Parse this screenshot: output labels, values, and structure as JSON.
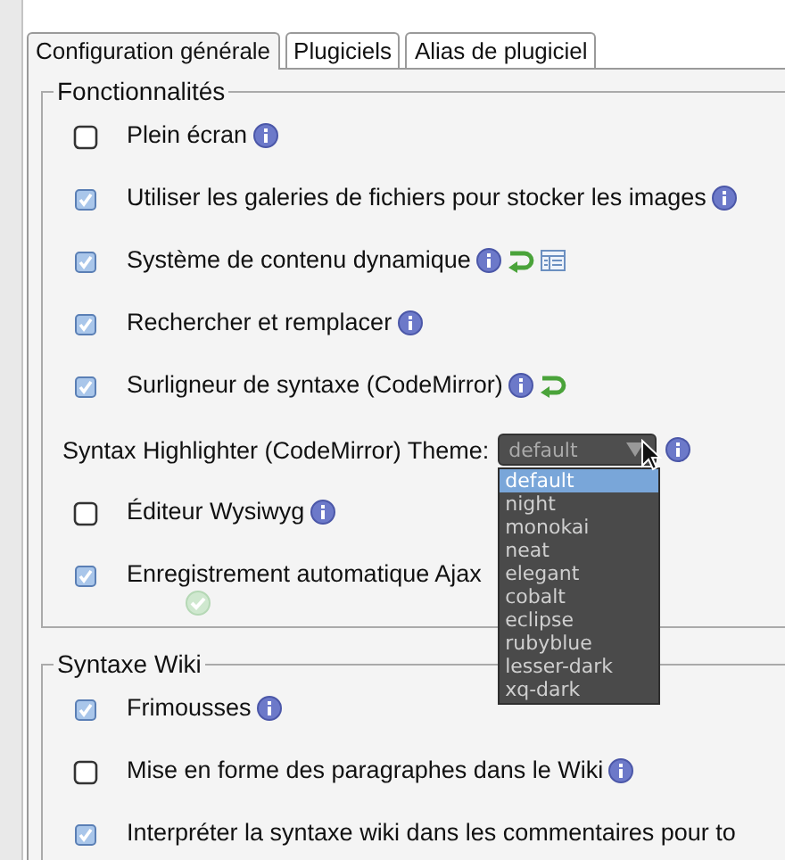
{
  "tabs": [
    {
      "label": "Configuration générale",
      "selected": true
    },
    {
      "label": "Plugiciels",
      "selected": false
    },
    {
      "label": "Alias de plugiciel",
      "selected": false
    }
  ],
  "sections": [
    {
      "legend": "Fonctionnalités",
      "rows": [
        {
          "kind": "checkbox",
          "label": "Plein écran",
          "checked": false,
          "icons": [
            {
              "kind": "info"
            }
          ]
        },
        {
          "kind": "checkbox",
          "label": "Utiliser les galeries de fichiers pour stocker les images",
          "checked": true,
          "icons": [
            {
              "kind": "info"
            }
          ]
        },
        {
          "kind": "checkbox",
          "label": "Système de contenu dynamique",
          "checked": true,
          "icons": [
            {
              "kind": "info"
            },
            {
              "kind": "undo"
            },
            {
              "kind": "table"
            }
          ]
        },
        {
          "kind": "checkbox",
          "label": "Rechercher et remplacer",
          "checked": true,
          "icons": [
            {
              "kind": "info"
            }
          ]
        },
        {
          "kind": "checkbox",
          "label": "Surligneur de syntaxe (CodeMirror)",
          "checked": true,
          "icons": [
            {
              "kind": "info"
            },
            {
              "kind": "undo"
            }
          ]
        },
        {
          "kind": "select",
          "label": "Syntax Highlighter (CodeMirror) Theme:",
          "value": "default",
          "icons": [
            {
              "kind": "info"
            }
          ],
          "options": [
            {
              "label": "default",
              "selected": true
            },
            {
              "label": "night",
              "selected": false
            },
            {
              "label": "monokai",
              "selected": false
            },
            {
              "label": "neat",
              "selected": false
            },
            {
              "label": "elegant",
              "selected": false
            },
            {
              "label": "cobalt",
              "selected": false
            },
            {
              "label": "eclipse",
              "selected": false
            },
            {
              "label": "rubyblue",
              "selected": false
            },
            {
              "label": "lesser-dark",
              "selected": false
            },
            {
              "label": "xq-dark",
              "selected": false
            }
          ]
        },
        {
          "kind": "checkbox",
          "label": "Éditeur Wysiwyg",
          "checked": false,
          "icons": [
            {
              "kind": "info"
            }
          ]
        },
        {
          "kind": "checkbox",
          "label": "Enregistrement automatique Ajax",
          "checked": true,
          "below_icons": [
            {
              "kind": "ok"
            }
          ]
        }
      ]
    },
    {
      "legend": "Syntaxe Wiki",
      "rows": [
        {
          "kind": "checkbox",
          "label": "Frimousses",
          "checked": true,
          "icons": [
            {
              "kind": "info"
            }
          ]
        },
        {
          "kind": "checkbox",
          "label": "Mise en forme des paragraphes dans le Wiki",
          "checked": false,
          "icons": [
            {
              "kind": "info"
            }
          ]
        },
        {
          "kind": "checkbox",
          "label": "Interpréter la syntaxe wiki dans les commentaires pour to",
          "checked": true
        }
      ]
    }
  ]
}
